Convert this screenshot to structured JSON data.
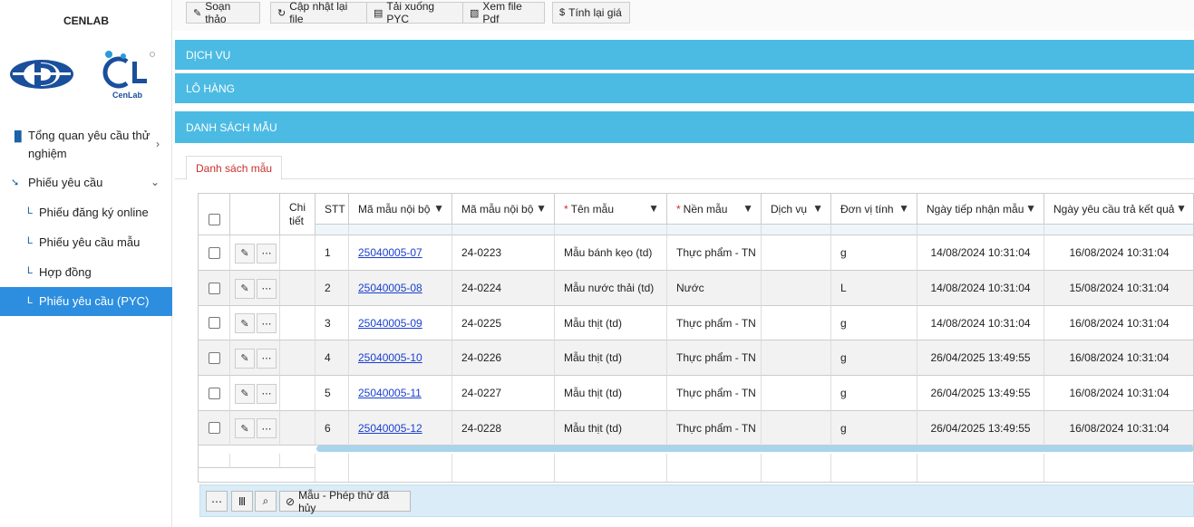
{
  "brand": "CENLAB",
  "logo_text": "CenLab",
  "sidebar": {
    "items": [
      {
        "label_line1": "Tổng quan yêu cầu thử",
        "label_line2": "nghiệm",
        "icon": "bar-chart-icon"
      },
      {
        "label": "Phiếu yêu cầu",
        "icon": "cursor-icon"
      },
      {
        "label": "Phiếu đăng ký online"
      },
      {
        "label": "Phiếu yêu cầu mẫu"
      },
      {
        "label": "Hợp đồng"
      },
      {
        "label": "Phiếu yêu cầu (PYC)"
      }
    ],
    "sub_icon": "L"
  },
  "toolbar": {
    "edit": "Soạn thảo",
    "refresh": "Cập nhật lại file",
    "download": "Tải xuống PYC",
    "pdf": "Xem file Pdf",
    "recalc": "Tính lại giá"
  },
  "sections": {
    "service": "DỊCH VỤ",
    "batch": "LÔ HÀNG",
    "samples": "DANH SÁCH MẪU"
  },
  "tab": "Danh sách mẫu",
  "grid": {
    "headers": {
      "detail_1": "Chi",
      "detail_2": "tiết",
      "stt": "STT",
      "code_internal": "Mã mẫu nội bộ",
      "code_internal_2": "Mã mẫu nội bộ",
      "name": "Tên mẫu",
      "matrix": "Nền mẫu",
      "service": "Dịch vụ",
      "unit": "Đơn vị tính",
      "received": "Ngày tiếp nhận mẫu",
      "due": "Ngày yêu cầu trả kết quả"
    },
    "rows": [
      {
        "stt": "1",
        "code": "25040005-07",
        "code2": "24-0223",
        "name": "Mẫu bánh kẹo (td)",
        "matrix": "Thực phẩm - TN",
        "service": "",
        "unit": "g",
        "received": "14/08/2024 10:31:04",
        "due": "16/08/2024 10:31:04"
      },
      {
        "stt": "2",
        "code": "25040005-08",
        "code2": "24-0224",
        "name": "Mẫu nước thải (td)",
        "matrix": "Nước",
        "service": "",
        "unit": "L",
        "received": "14/08/2024 10:31:04",
        "due": "15/08/2024 10:31:04"
      },
      {
        "stt": "3",
        "code": "25040005-09",
        "code2": "24-0225",
        "name": "Mẫu thịt (td)",
        "matrix": "Thực phẩm - TN",
        "service": "",
        "unit": "g",
        "received": "14/08/2024 10:31:04",
        "due": "16/08/2024 10:31:04"
      },
      {
        "stt": "4",
        "code": "25040005-10",
        "code2": "24-0226",
        "name": "Mẫu thịt (td)",
        "matrix": "Thực phẩm - TN",
        "service": "",
        "unit": "g",
        "received": "26/04/2025 13:49:55",
        "due": "16/08/2024 10:31:04"
      },
      {
        "stt": "5",
        "code": "25040005-11",
        "code2": "24-0227",
        "name": "Mẫu thịt (td)",
        "matrix": "Thực phẩm - TN",
        "service": "",
        "unit": "g",
        "received": "26/04/2025 13:49:55",
        "due": "16/08/2024 10:31:04"
      },
      {
        "stt": "6",
        "code": "25040005-12",
        "code2": "24-0228",
        "name": "Mẫu thịt (td)",
        "matrix": "Thực phẩm - TN",
        "service": "",
        "unit": "g",
        "received": "26/04/2025 13:49:55",
        "due": "16/08/2024 10:31:04"
      }
    ]
  },
  "bottombar": {
    "cancelled": "Mẫu - Phép thử đã hủy"
  },
  "colors": {
    "section": "#4cbbe3",
    "active_nav": "#2d8ee0",
    "link": "#1a3fcf"
  }
}
